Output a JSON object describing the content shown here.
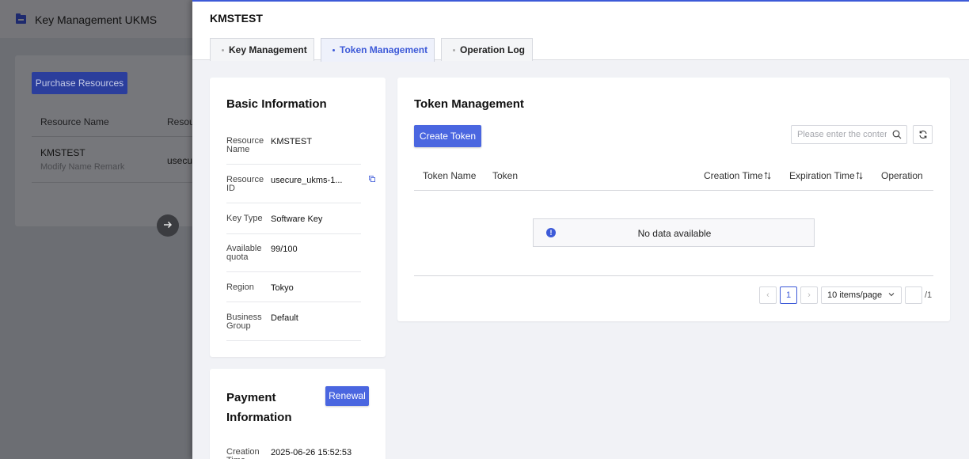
{
  "background": {
    "header_title": "Key Management UKMS",
    "purchase_button": "Purchase Resources",
    "table_headers": [
      "Resource Name",
      "Resou"
    ],
    "row": {
      "name": "KMSTEST",
      "remark": "Modify Name Remark",
      "id": "usecur"
    }
  },
  "drawer": {
    "title": "KMSTEST",
    "tabs": [
      {
        "label": "Key Management"
      },
      {
        "label": "Token Management"
      },
      {
        "label": "Operation Log"
      }
    ],
    "active_tab": "Token Management"
  },
  "basic_info": {
    "title": "Basic Information",
    "rows": [
      {
        "label": "Resource Name",
        "value": "KMSTEST"
      },
      {
        "label": "Resource ID",
        "value": "usecure_ukms-1..."
      },
      {
        "label": "Key Type",
        "value": "Software Key"
      },
      {
        "label": "Available quota",
        "value": "99/100"
      },
      {
        "label": "Region",
        "value": "Tokyo"
      },
      {
        "label": "Business Group",
        "value": "Default"
      }
    ]
  },
  "payment_info": {
    "title": "Payment Information",
    "renewal_button": "Renewal",
    "rows": [
      {
        "label": "Creation Time",
        "value": "2025-06-26 15:52:53"
      }
    ]
  },
  "token_mgmt": {
    "title": "Token Management",
    "create_button": "Create Token",
    "search_placeholder": "Please enter the conter",
    "columns": [
      "Token Name",
      "Token",
      "Creation Time",
      "Expiration Time",
      "Operation"
    ],
    "empty_text": "No data available",
    "pagination": {
      "prev": "‹",
      "current_page": "1",
      "next": "›",
      "page_size": "10 items/page",
      "total_pages": "/1"
    }
  },
  "colors": {
    "accent": "#3d5ad8",
    "primary_button": "#4a66e0",
    "overlay": "#6c6e73"
  },
  "icons": [
    "folder-icon",
    "arrow-right-icon",
    "copy-icon",
    "search-icon",
    "refresh-icon",
    "sort-icon",
    "info-icon",
    "chevron-down-icon"
  ]
}
